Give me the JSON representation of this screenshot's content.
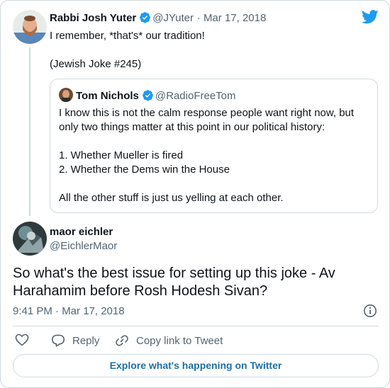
{
  "parent": {
    "name": "Rabbi Josh Yuter",
    "handle": "@JYuter",
    "separator": "·",
    "date": "Mar 17, 2018",
    "lines": [
      "I remember, *that's* our tradition!",
      "(Jewish Joke #245)"
    ]
  },
  "quote": {
    "name": "Tom Nichols",
    "handle": "@RadioFreeTom",
    "lines": [
      "I know this is not the calm response people want right now, but only two things matter at this point in our political history:",
      "1. Whether Mueller is fired",
      "2. Whether the Dems win the House",
      "All the other stuff is just us yelling at each other."
    ]
  },
  "reply": {
    "name": "maor eichler",
    "handle": "@EichlerMaor",
    "text": "So what's the best issue for setting up this joke - Av Harahamim before Rosh Hodesh Sivan?",
    "timestamp": "9:41 PM · Mar 17, 2018"
  },
  "actions": {
    "reply_label": "Reply",
    "copy_label": "Copy link to Tweet",
    "explore_label": "Explore what's happening on Twitter"
  },
  "icons": {
    "brand": "twitter-bird-icon",
    "verified": "verified-badge-icon",
    "info": "info-icon",
    "like": "heart-icon",
    "reply": "speech-bubble-icon",
    "copy": "link-icon"
  },
  "colors": {
    "twitter_blue": "#1d9bf0",
    "link_blue": "#1d6fa5",
    "secondary_text": "#536471",
    "border": "#cfd9de"
  }
}
